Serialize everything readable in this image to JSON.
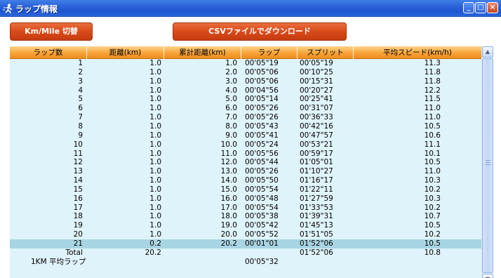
{
  "window": {
    "title": "ラップ情報",
    "minimize": "_",
    "maximize": "□",
    "close": "×"
  },
  "toolbar": {
    "unit_toggle_label": "Km/Mile 切替",
    "csv_download_label": "CSVファイルでダウンロード"
  },
  "table": {
    "columns": [
      "ラップ数",
      "距離(km)",
      "累計距離(km)",
      "ラップ",
      "スプリット",
      "平均スピード(km/h)"
    ],
    "rows": [
      {
        "lap": "1",
        "distance": "1.0",
        "cumulative": "1.0",
        "lap_time": "00'05\"19",
        "split": "00'05\"19",
        "speed": "11.3"
      },
      {
        "lap": "2",
        "distance": "1.0",
        "cumulative": "2.0",
        "lap_time": "00'05\"06",
        "split": "00'10\"25",
        "speed": "11.8"
      },
      {
        "lap": "3",
        "distance": "1.0",
        "cumulative": "3.0",
        "lap_time": "00'05\"06",
        "split": "00'15\"31",
        "speed": "11.8"
      },
      {
        "lap": "4",
        "distance": "1.0",
        "cumulative": "4.0",
        "lap_time": "00'04\"56",
        "split": "00'20\"27",
        "speed": "12.2"
      },
      {
        "lap": "5",
        "distance": "1.0",
        "cumulative": "5.0",
        "lap_time": "00'05\"14",
        "split": "00'25\"41",
        "speed": "11.5"
      },
      {
        "lap": "6",
        "distance": "1.0",
        "cumulative": "6.0",
        "lap_time": "00'05\"26",
        "split": "00'31\"07",
        "speed": "11.0"
      },
      {
        "lap": "7",
        "distance": "1.0",
        "cumulative": "7.0",
        "lap_time": "00'05\"26",
        "split": "00'36\"33",
        "speed": "11.0"
      },
      {
        "lap": "8",
        "distance": "1.0",
        "cumulative": "8.0",
        "lap_time": "00'05\"43",
        "split": "00'42\"16",
        "speed": "10.5"
      },
      {
        "lap": "9",
        "distance": "1.0",
        "cumulative": "9.0",
        "lap_time": "00'05\"41",
        "split": "00'47\"57",
        "speed": "10.6"
      },
      {
        "lap": "10",
        "distance": "1.0",
        "cumulative": "10.0",
        "lap_time": "00'05\"24",
        "split": "00'53\"21",
        "speed": "11.1"
      },
      {
        "lap": "11",
        "distance": "1.0",
        "cumulative": "11.0",
        "lap_time": "00'05\"56",
        "split": "00'59\"17",
        "speed": "10.1"
      },
      {
        "lap": "12",
        "distance": "1.0",
        "cumulative": "12.0",
        "lap_time": "00'05\"44",
        "split": "01'05\"01",
        "speed": "10.5"
      },
      {
        "lap": "13",
        "distance": "1.0",
        "cumulative": "13.0",
        "lap_time": "00'05\"26",
        "split": "01'10\"27",
        "speed": "11.0"
      },
      {
        "lap": "14",
        "distance": "1.0",
        "cumulative": "14.0",
        "lap_time": "00'05\"50",
        "split": "01'16\"17",
        "speed": "10.3"
      },
      {
        "lap": "15",
        "distance": "1.0",
        "cumulative": "15.0",
        "lap_time": "00'05\"54",
        "split": "01'22\"11",
        "speed": "10.2"
      },
      {
        "lap": "16",
        "distance": "1.0",
        "cumulative": "16.0",
        "lap_time": "00'05\"48",
        "split": "01'27\"59",
        "speed": "10.3"
      },
      {
        "lap": "17",
        "distance": "1.0",
        "cumulative": "17.0",
        "lap_time": "00'05\"54",
        "split": "01'33\"53",
        "speed": "10.2"
      },
      {
        "lap": "18",
        "distance": "1.0",
        "cumulative": "18.0",
        "lap_time": "00'05\"38",
        "split": "01'39\"31",
        "speed": "10.7"
      },
      {
        "lap": "19",
        "distance": "1.0",
        "cumulative": "19.0",
        "lap_time": "00'05\"42",
        "split": "01'45\"13",
        "speed": "10.5"
      },
      {
        "lap": "20",
        "distance": "1.0",
        "cumulative": "20.0",
        "lap_time": "00'05\"52",
        "split": "01'51\"05",
        "speed": "10.2"
      },
      {
        "lap": "21",
        "distance": "0.2",
        "cumulative": "20.2",
        "lap_time": "00'01\"01",
        "split": "01'52\"06",
        "speed": "10.5",
        "selected": true
      }
    ],
    "total": {
      "label": "Total",
      "distance": "20.2",
      "split": "01'52\"06",
      "speed": "10.8"
    },
    "average": {
      "label": "1KM 平均ラップ",
      "lap_time": "00'05\"32"
    }
  },
  "scrollbar": {
    "up": "▲",
    "down": "▼"
  }
}
